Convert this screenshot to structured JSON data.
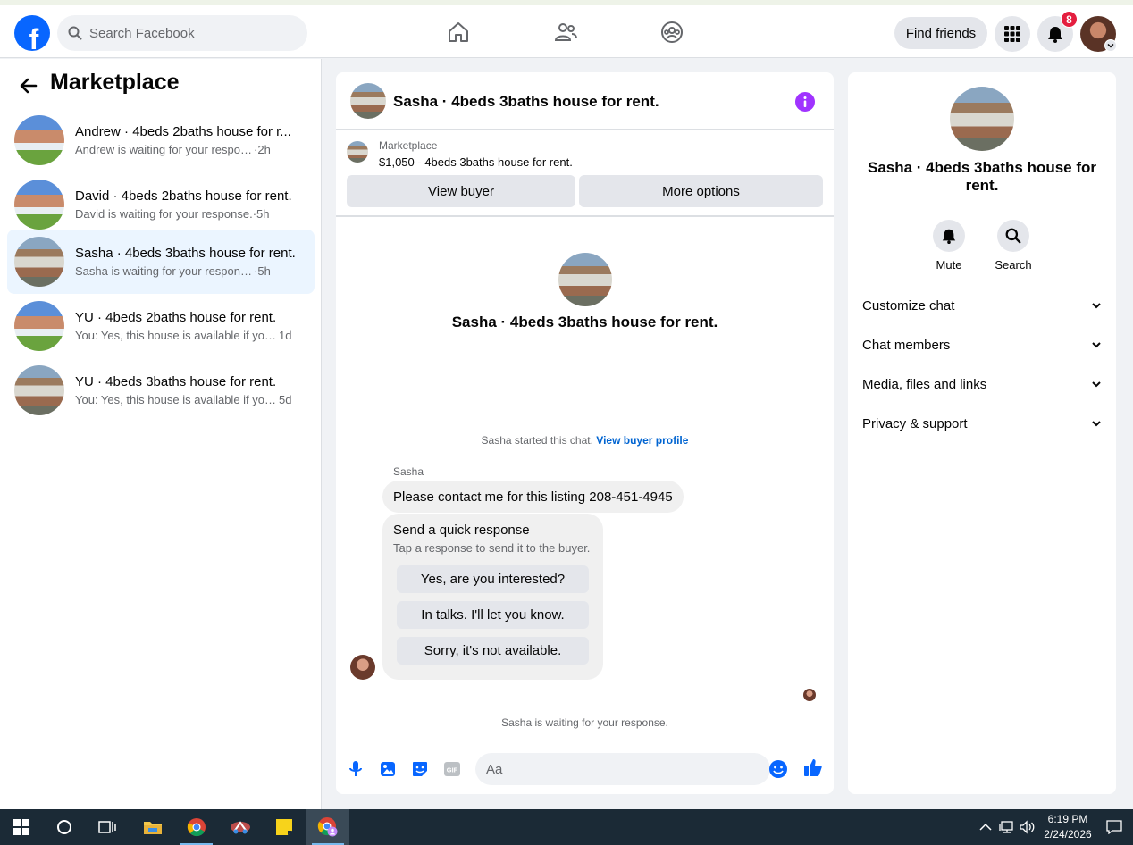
{
  "topnav": {
    "logo_letter": "f",
    "search_placeholder": "Search Facebook",
    "find_friends_label": "Find friends",
    "notification_count": "8"
  },
  "sidebar": {
    "title": "Marketplace",
    "conversations": [
      {
        "name": "Andrew · 4beds 2baths house for r...",
        "message": "Andrew is waiting for your response.",
        "time": "2h",
        "separator": " · "
      },
      {
        "name": "David · 4beds 2baths house for rent.",
        "message": "David is waiting for your response.",
        "time": "5h",
        "separator": " · "
      },
      {
        "name": "Sasha · 4beds 3baths house for rent.",
        "message": "Sasha is waiting for your response.",
        "time": "5h",
        "separator": " · "
      },
      {
        "name": "YU · 4beds 2baths house for rent.",
        "message": "You: Yes, this house is available if you ...",
        "time": "1d",
        "separator": " "
      },
      {
        "name": "YU · 4beds 3baths house for rent.",
        "message": "You: Yes, this house is available if you ...",
        "time": "5d",
        "separator": " "
      }
    ]
  },
  "chat": {
    "title": "Sasha · 4beds 3baths house for rent.",
    "listing_label": "Marketplace",
    "listing_price": "$1,050 - 4beds 3baths house for rent.",
    "view_buyer_label": "View buyer",
    "more_options_label": "More options",
    "intro_title": "Sasha · 4beds 3baths house for rent.",
    "started_text": "Sasha started this chat.",
    "view_profile_link": "View buyer profile",
    "sender_name": "Sasha",
    "message": "Please contact me for this listing 208-451-4945",
    "quick_title": "Send a quick response",
    "quick_subtitle": "Tap a response to send it to the buyer.",
    "quick_responses": [
      "Yes, are you interested?",
      "In talks. I'll let you know.",
      "Sorry, it's not available."
    ],
    "waiting_text": "Sasha is waiting for your response.",
    "input_placeholder": "Aa"
  },
  "details": {
    "title": "Sasha · 4beds 3baths house for rent.",
    "mute_label": "Mute",
    "search_label": "Search",
    "sections": [
      "Customize chat",
      "Chat members",
      "Media, files and links",
      "Privacy & support"
    ]
  },
  "taskbar": {
    "time": "6:19 PM",
    "date": "2/24/2026"
  },
  "colors": {
    "brand": "#0866ff",
    "info": "#a033ff",
    "active_row": "#ebf5ff",
    "badge": "#e41e3f"
  }
}
